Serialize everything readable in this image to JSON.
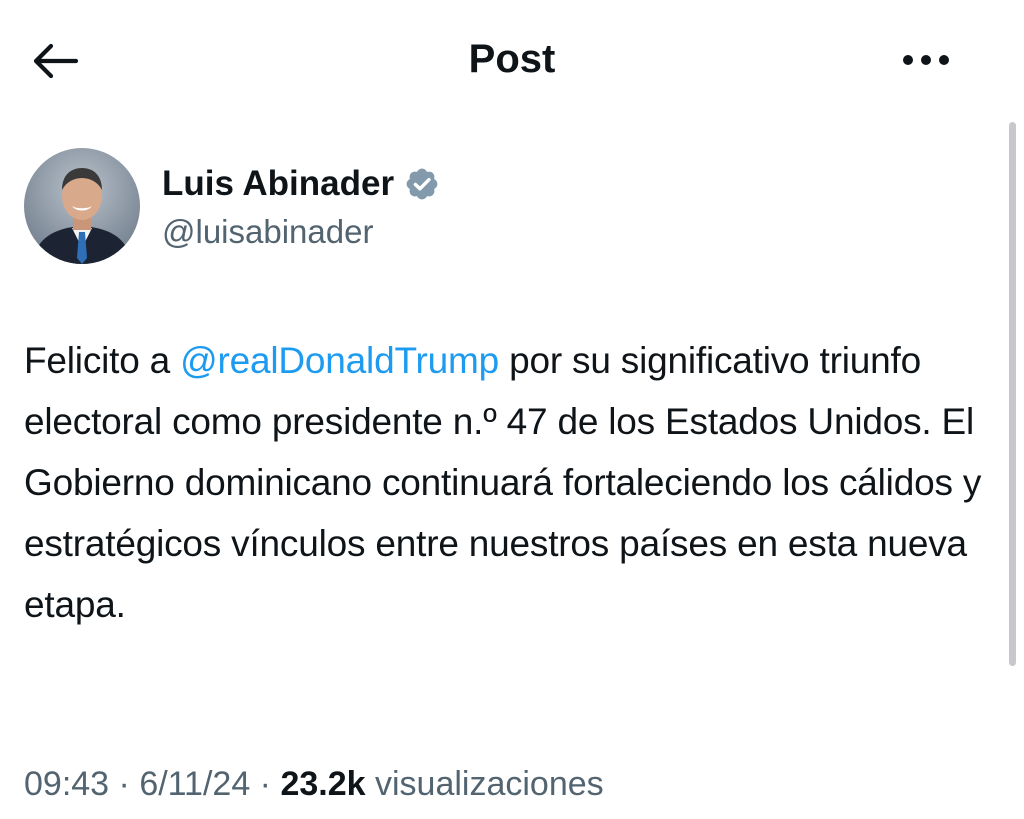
{
  "header": {
    "title": "Post",
    "back_icon": "arrow-left-icon",
    "more_icon": "ellipsis-horizontal-icon"
  },
  "author": {
    "display_name": "Luis Abinader",
    "handle": "@luisabinader",
    "verified_icon": "verified-badge-icon",
    "verified_color": "#829aab"
  },
  "post": {
    "text_before_mention": "Felicito a ",
    "mention": "@realDonaldTrump",
    "text_after_mention": " por su significativo triunfo electoral como presidente n.º 47 de los Estados Unidos. El Gobierno dominicano continuará fortaleciendo los cálidos y estratégicos vínculos entre nuestros países en esta nueva etapa.",
    "mention_color": "#1d9bf0"
  },
  "meta": {
    "time": "09:43",
    "separator": " · ",
    "date": "6/11/24",
    "views_count": "23.2k",
    "views_label": " visualizaciones"
  },
  "colors": {
    "text_primary": "#0f1419",
    "text_secondary": "#536471",
    "background": "#ffffff"
  }
}
